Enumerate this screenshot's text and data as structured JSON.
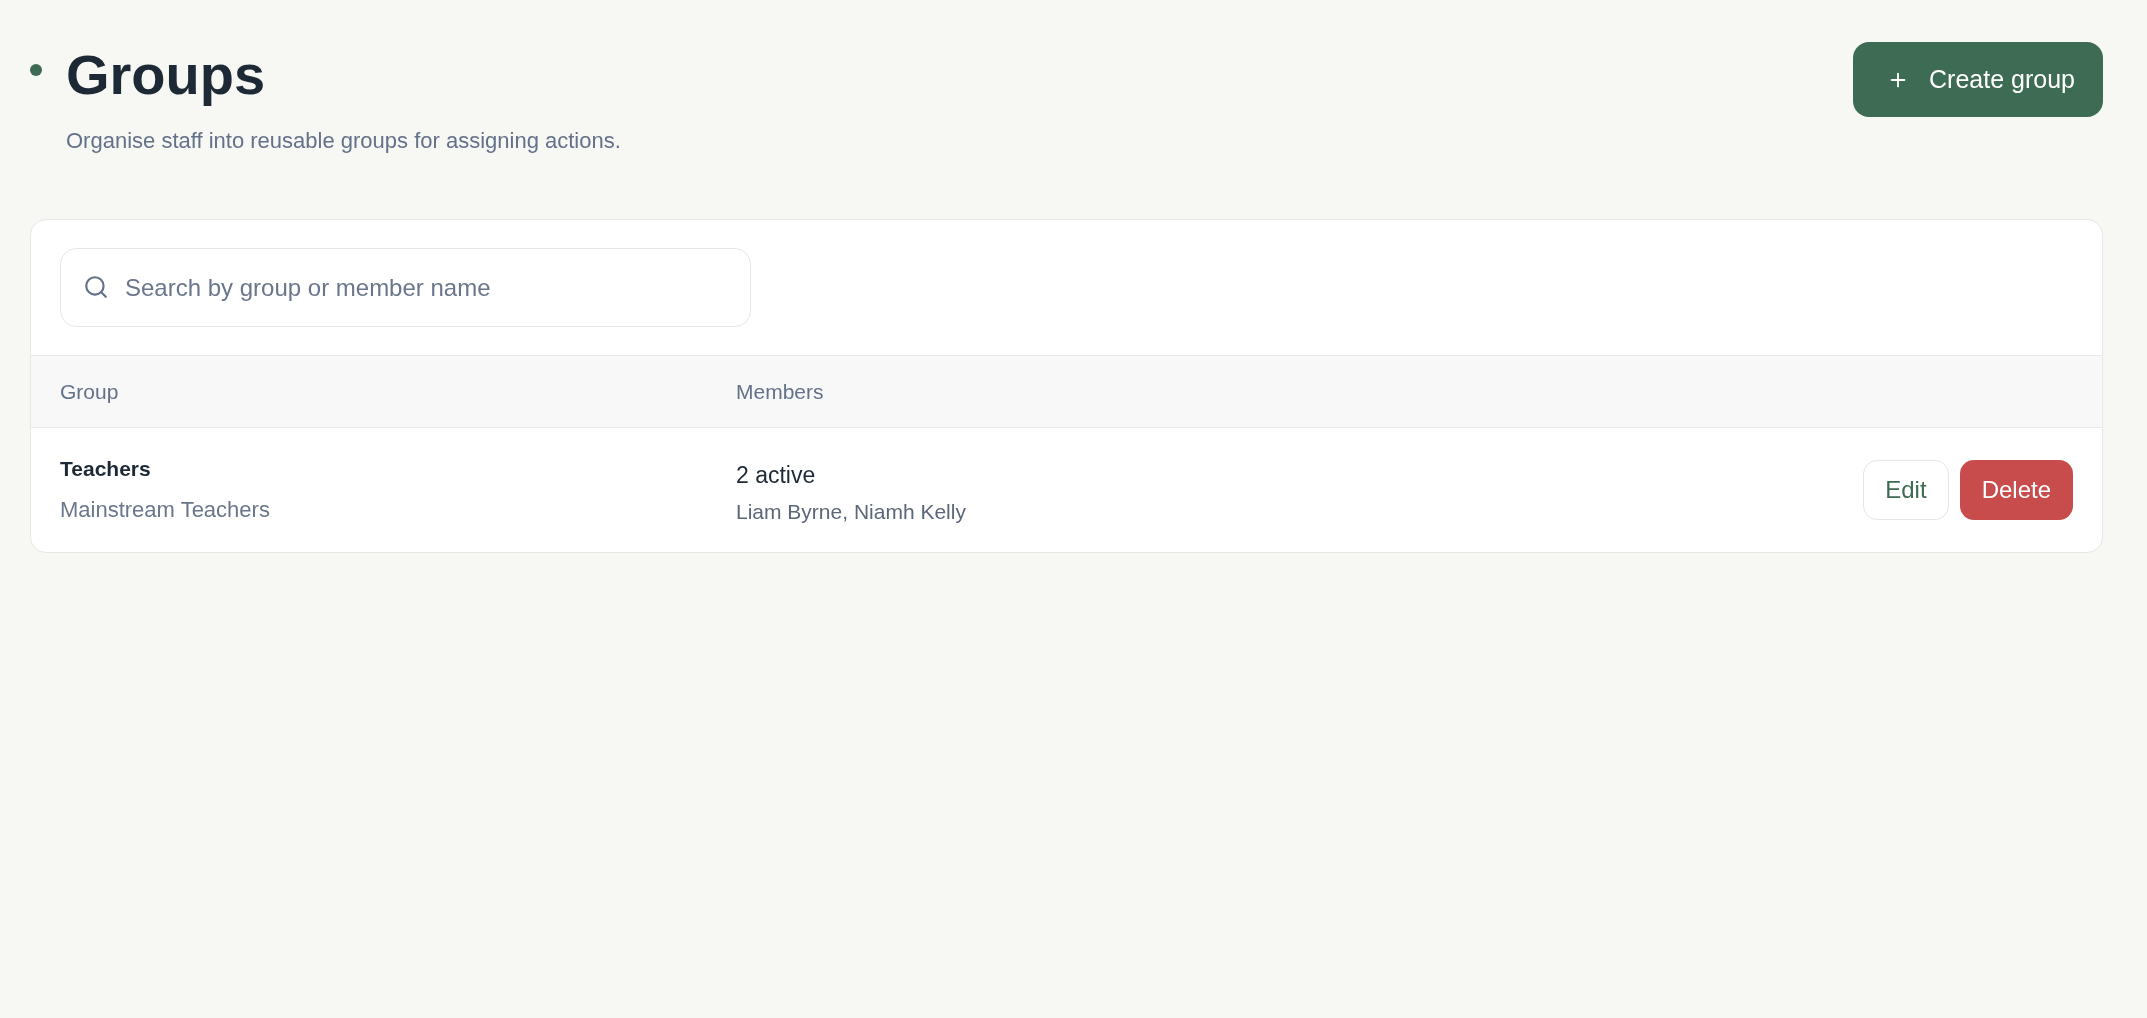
{
  "page": {
    "title": "Groups",
    "subtitle": "Organise staff into reusable groups for assigning actions."
  },
  "create_button": {
    "label": "Create group"
  },
  "search": {
    "placeholder": "Search by group or member name"
  },
  "table": {
    "columns": [
      "Group",
      "Members"
    ],
    "rows": [
      {
        "name": "Teachers",
        "description": "Mainstream Teachers",
        "member_count": "2 active",
        "members": "Liam Byrne, Niamh Kelly",
        "actions": [
          {
            "kind": "secondary",
            "label": "Edit"
          },
          {
            "kind": "danger",
            "label": "Delete"
          }
        ]
      }
    ]
  }
}
